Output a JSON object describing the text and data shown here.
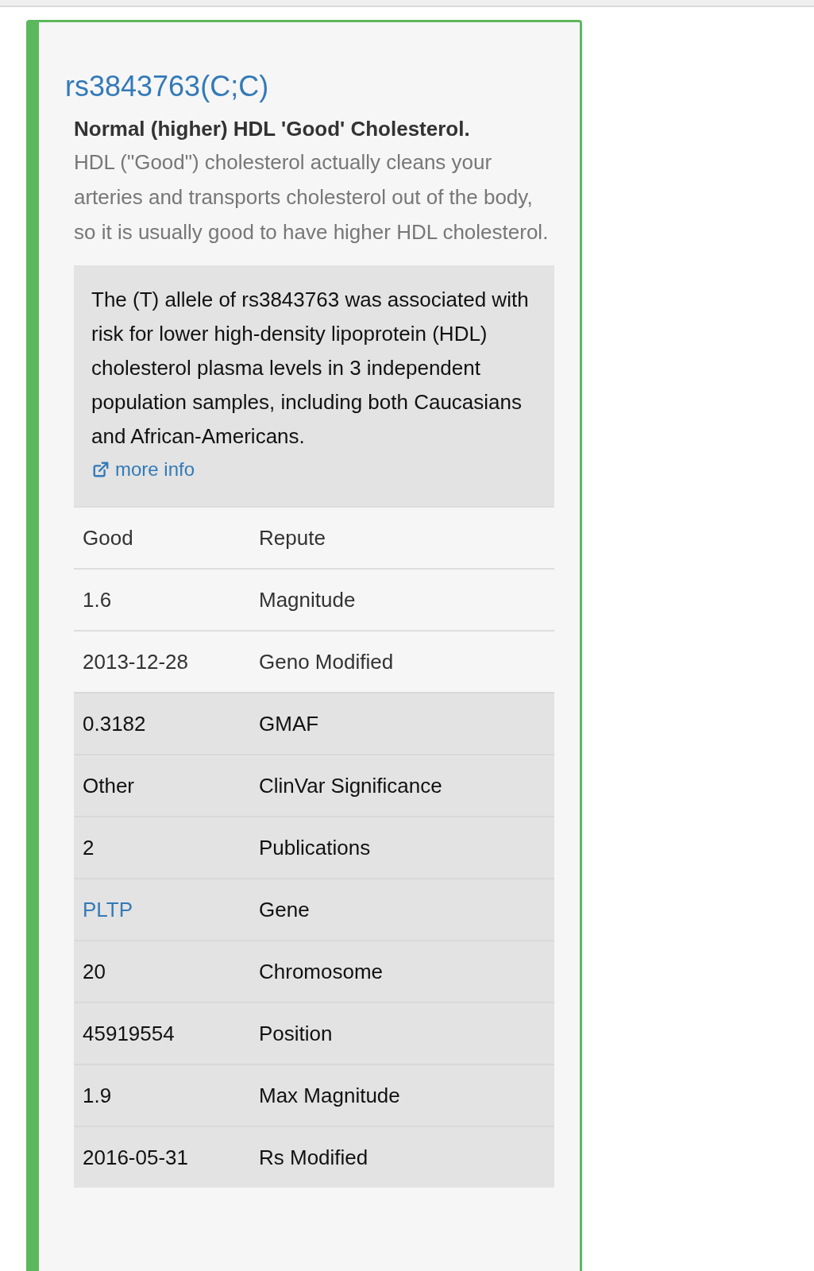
{
  "genotype": {
    "title": "rs3843763(C;C)",
    "summary_heading": "Normal (higher) HDL 'Good' Cholesterol.",
    "summary_text": "HDL (\"Good\") cholesterol actually cleans your arteries and transports cholesterol out of the body, so it is usually good to have higher HDL cholesterol.",
    "note": {
      "text": "The (T) allele of rs3843763 was associated with risk for lower high-density lipoprotein (HDL) cholesterol plasma levels in 3 independent population samples, including both Caucasians and African-Americans.",
      "link": "more info"
    },
    "rows": [
      {
        "kind": "plain",
        "value": "Good",
        "label": "Repute",
        "value_link": false
      },
      {
        "kind": "plain",
        "value": "1.6",
        "label": "Magnitude",
        "value_link": false
      },
      {
        "kind": "plain",
        "value": "2013-12-28",
        "label": "Geno Modified",
        "value_link": false
      },
      {
        "kind": "shaded",
        "value": "0.3182",
        "label": "GMAF",
        "value_link": false
      },
      {
        "kind": "shaded",
        "value": "Other",
        "label": "ClinVar Significance",
        "value_link": false
      },
      {
        "kind": "shaded",
        "value": "2",
        "label": "Publications",
        "value_link": false
      },
      {
        "kind": "shaded",
        "value": "PLTP",
        "label": "Gene",
        "value_link": true
      },
      {
        "kind": "shaded",
        "value": "20",
        "label": "Chromosome",
        "value_link": false
      },
      {
        "kind": "shaded",
        "value": "45919554",
        "label": "Position",
        "value_link": false
      },
      {
        "kind": "shaded",
        "value": "1.9",
        "label": "Max Magnitude",
        "value_link": false
      },
      {
        "kind": "shaded",
        "value": "2016-05-31",
        "label": "Rs Modified",
        "value_link": false
      }
    ]
  }
}
